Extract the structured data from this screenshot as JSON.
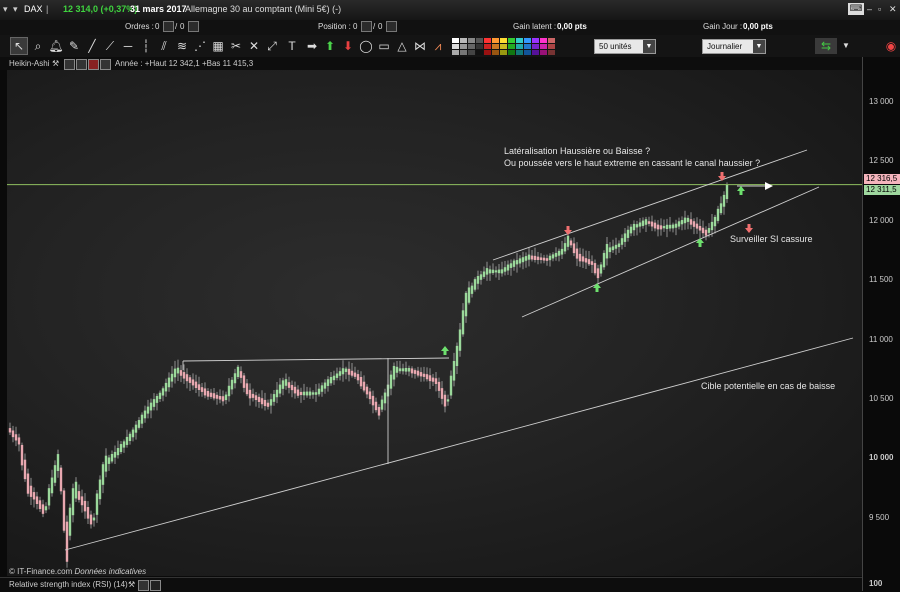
{
  "titlebar": {
    "symbol": "DAX",
    "price_change": "12 314,0 (+0,37%)",
    "date": "31 mars 2017",
    "instrument": "Allemagne 30 au comptant (Mini 5€) (-)"
  },
  "orders_bar": {
    "orders_label": "Ordres :",
    "orders_a": "0",
    "orders_b": "0",
    "position_label": "Position :",
    "position_a": "0",
    "position_b": "0",
    "gain_latent_label": "Gain latent :",
    "gain_latent_value": "0,00 pts",
    "gain_jour_label": "Gain Jour :",
    "gain_jour_value": "0,00 pts"
  },
  "toolbar": {
    "units": "50 unités",
    "period": "Journalier"
  },
  "chart_header": {
    "chart_type": "Heikin-Ashi",
    "range_text": "Année : +Haut 12 342,1 +Bas 11 415,3"
  },
  "chart_data": {
    "type": "candlestick",
    "style": "Heikin-Ashi",
    "y_ticks": [
      "13 000",
      "12 500",
      "12 000",
      "11 500",
      "11 000",
      "10 500",
      "10 000",
      "9 500"
    ],
    "ylim": [
      9200,
      13300
    ],
    "price_tags": [
      "12 316,5",
      "12 311,5"
    ],
    "horizontal_line": 12311.5,
    "colors": {
      "up": "#9bd89b",
      "down": "#e8a8b0",
      "line": "#cfcfcf",
      "hline": "#8fbf5f",
      "arrow_up": "#6ee06e",
      "arrow_down": "#f07070"
    }
  },
  "annotations": {
    "question_line1": "Latéralisation Haussière ou Baisse ?",
    "question_line2": "Ou poussée vers le haut extreme en cassant le canal haussier ?",
    "watch": "Surveiller SI cassure",
    "target": "Cible potentielle en cas de baisse"
  },
  "footer": {
    "copyright": "© IT-Finance.com",
    "disclaimer": "Données indicatives",
    "indicator": "Relative strength index (RSI) (14)",
    "indicator_axis": "100"
  }
}
